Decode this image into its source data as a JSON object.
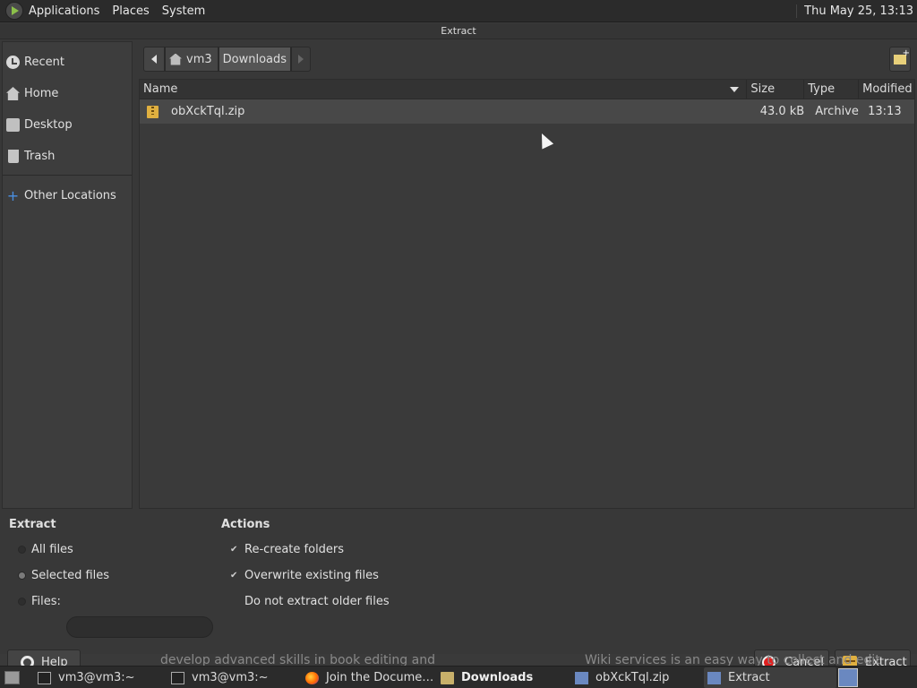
{
  "top_panel": {
    "menus": [
      "Applications",
      "Places",
      "System"
    ],
    "clock": "Thu May 25, 13:13"
  },
  "dialog": {
    "title": "Extract",
    "sidebar": {
      "items": [
        {
          "label": "Recent",
          "icon": "recent-icon"
        },
        {
          "label": "Home",
          "icon": "home-icon"
        },
        {
          "label": "Desktop",
          "icon": "desktop-icon"
        },
        {
          "label": "Trash",
          "icon": "trash-icon"
        }
      ],
      "other": {
        "label": "Other Locations",
        "icon": "plus-icon"
      }
    },
    "pathbar": {
      "home_label": "vm3",
      "current": "Downloads"
    },
    "file_list": {
      "columns": {
        "name": "Name",
        "size": "Size",
        "type": "Type",
        "modified": "Modified"
      },
      "rows": [
        {
          "name": "obXckTql.zip",
          "size": "43.0 kB",
          "type": "Archive",
          "modified": "13:13"
        }
      ]
    },
    "extract_options": {
      "title": "Extract",
      "all_files": "All files",
      "selected_files": "Selected files",
      "files": "Files:",
      "selected": "Selected files"
    },
    "actions": {
      "title": "Actions",
      "recreate": "Re-create folders",
      "overwrite": "Overwrite existing files",
      "no_older": "Do not extract older files"
    },
    "buttons": {
      "help": "Help",
      "cancel": "Cancel",
      "extract": "Extract"
    }
  },
  "background_text": {
    "left": "develop advanced skills in book editing and",
    "right": "Wiki services is an easy way to collect and edit"
  },
  "taskbar": {
    "items": [
      {
        "label": "vm3@vm3:~"
      },
      {
        "label": "vm3@vm3:~"
      },
      {
        "label": "Join the Docume…"
      },
      {
        "label": "Downloads"
      },
      {
        "label": "obXckTql.zip"
      },
      {
        "label": "Extract"
      }
    ]
  }
}
